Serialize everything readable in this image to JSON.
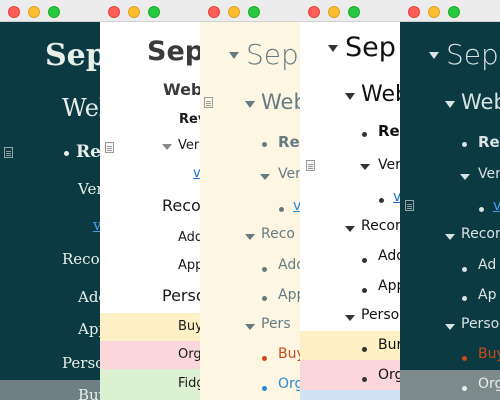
{
  "windows": [
    {
      "id": "dark-serif-left",
      "title": "Sep",
      "heading": "Web",
      "item_1": "Re",
      "item_2": "Ver",
      "link": "v",
      "section_2": "Recor",
      "row_add": "Ado",
      "row_app": "App",
      "section_3": "Person",
      "row_buy": "Buy"
    },
    {
      "id": "white-sans",
      "title": "Sep",
      "heading": "Web",
      "item_1": "Rev",
      "item_2": "Veri",
      "link": "v",
      "section_2": "Reco",
      "row_add": "Add",
      "row_app": "App",
      "section_3": "Perso",
      "row_buy": "Buy",
      "row_org": "Org",
      "row_fidg": "Fidg"
    },
    {
      "id": "cream-solarized",
      "title": "Sep",
      "heading": "Web",
      "item_1": "Re",
      "item_2": "Ver",
      "link": "v",
      "section_2": "Reco",
      "row_add": "Ado",
      "row_app": "App",
      "section_3": "Pers",
      "row_buy": "Buy",
      "row_org": "Org"
    },
    {
      "id": "white-outline",
      "title": "Sep",
      "heading": "Web",
      "item_1": "Re",
      "item_2": "Ver",
      "link": "v",
      "section_2": "Recor",
      "row_add": "Add",
      "row_app": "App",
      "section_3": "Perso",
      "row_buy": "Bur",
      "row_org": "Org"
    },
    {
      "id": "dark-right",
      "title": "Sep",
      "heading": "Web",
      "item_1": "Re",
      "item_2": "Ver",
      "link": "v",
      "section_2": "Recor",
      "row_add": "Ad",
      "row_app": "Ap",
      "section_3": "Perso",
      "row_buy": "Buy",
      "row_org": "Org"
    }
  ],
  "colors": {
    "dark_bg": "#0b3a42",
    "dark_text": "#e8efe9",
    "cream_bg": "#fdf6e3",
    "cream_text": "#657b83",
    "link_blue": "#1f6fd0",
    "buy_orange": "#cb4b16",
    "org_blue": "#268bd2",
    "band_yellow": "#fdf0c4",
    "band_pink": "#fbd7dc",
    "band_green": "#dcf1d2",
    "band_gray": "#7d8a8c"
  }
}
